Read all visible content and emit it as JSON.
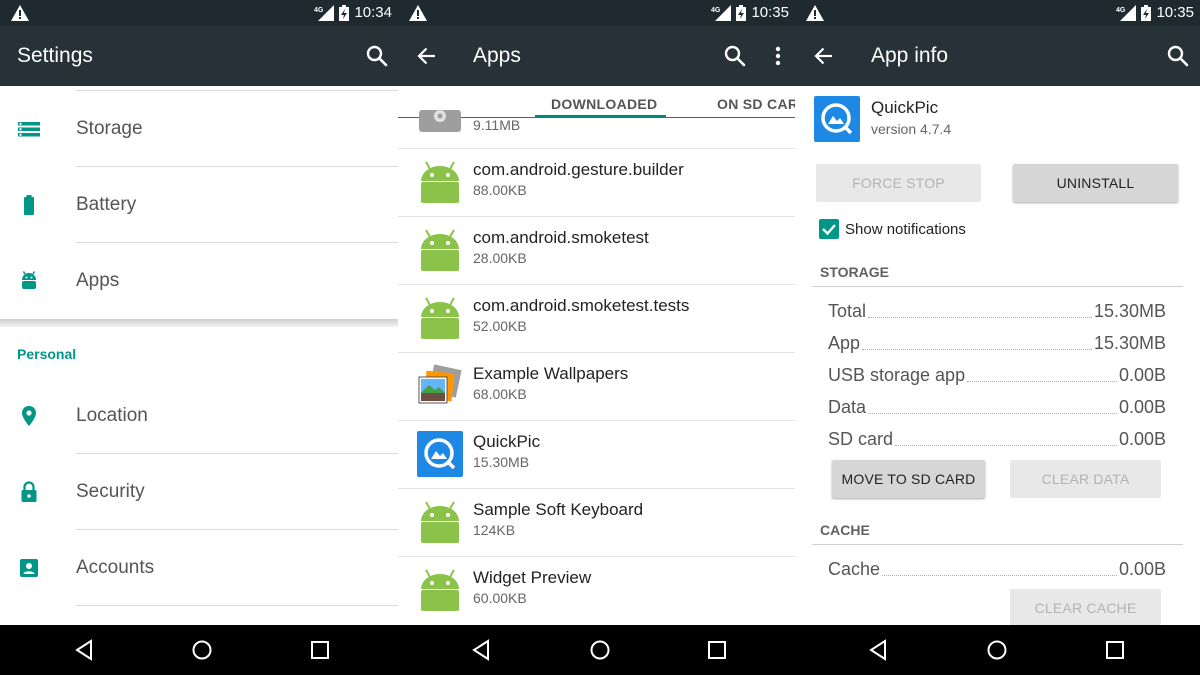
{
  "colors": {
    "statusbar": "#1f2a30",
    "toolbar": "#263238",
    "accent": "#009688",
    "android_green": "#8bc34a"
  },
  "screen1": {
    "time": "10:34",
    "title": "Settings",
    "items_top": [
      {
        "label": "Storage",
        "icon": "storage-icon"
      },
      {
        "label": "Battery",
        "icon": "battery-icon"
      },
      {
        "label": "Apps",
        "icon": "android-icon"
      }
    ],
    "section": "Personal",
    "items_bottom": [
      {
        "label": "Location",
        "icon": "location-icon"
      },
      {
        "label": "Security",
        "icon": "lock-icon"
      },
      {
        "label": "Accounts",
        "icon": "account-icon"
      }
    ]
  },
  "screen2": {
    "time": "10:35",
    "title": "Apps",
    "tabs": [
      "DOWNLOADED",
      "ON SD CARD"
    ],
    "partial_row_size": "9.11MB",
    "apps": [
      {
        "name": "com.android.gesture.builder",
        "size": "88.00KB",
        "icon": "android-icon"
      },
      {
        "name": "com.android.smoketest",
        "size": "28.00KB",
        "icon": "android-icon"
      },
      {
        "name": "com.android.smoketest.tests",
        "size": "52.00KB",
        "icon": "android-icon"
      },
      {
        "name": "Example Wallpapers",
        "size": "68.00KB",
        "icon": "wallpapers-icon"
      },
      {
        "name": "QuickPic",
        "size": "15.30MB",
        "icon": "quickpic-icon"
      },
      {
        "name": "Sample Soft Keyboard",
        "size": "124KB",
        "icon": "android-icon"
      },
      {
        "name": "Widget Preview",
        "size": "60.00KB",
        "icon": "android-icon"
      }
    ]
  },
  "screen3": {
    "time": "10:35",
    "title": "App info",
    "app_name": "QuickPic",
    "app_version": "version 4.7.4",
    "force_stop": "FORCE STOP",
    "uninstall": "UNINSTALL",
    "show_notifications": "Show notifications",
    "show_notifications_checked": true,
    "storage_title": "STORAGE",
    "storage": [
      {
        "label": "Total",
        "value": "15.30MB"
      },
      {
        "label": "App",
        "value": "15.30MB"
      },
      {
        "label": "USB storage app",
        "value": "0.00B"
      },
      {
        "label": "Data",
        "value": "0.00B"
      },
      {
        "label": "SD card",
        "value": "0.00B"
      }
    ],
    "move_to_sd": "MOVE TO SD CARD",
    "clear_data": "CLEAR DATA",
    "cache_title": "CACHE",
    "cache": {
      "label": "Cache",
      "value": "0.00B"
    },
    "clear_cache": "CLEAR CACHE"
  },
  "status_icons": [
    "warning-icon",
    "network-4g-icon",
    "battery-charging-icon"
  ],
  "nav_icons": [
    "back-nav-icon",
    "home-nav-icon",
    "recents-nav-icon"
  ]
}
